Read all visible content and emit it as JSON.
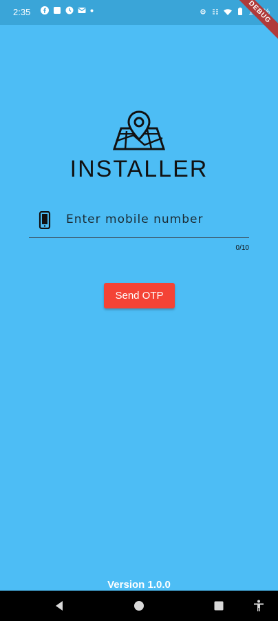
{
  "status_bar": {
    "time": "2:35",
    "left_icons": [
      "facebook-icon",
      "square-notification-icon",
      "clock-icon",
      "gmail-icon",
      "dot-icon"
    ],
    "right_icons": [
      "vibrate-icon",
      "data-icon",
      "wifi-icon",
      "battery-icon"
    ],
    "battery": "100%"
  },
  "debug_banner": "DEBUG",
  "app": {
    "title": "INSTALLER",
    "logo_icon": "map-location-icon"
  },
  "mobile_field": {
    "placeholder": "Enter mobile number",
    "value": "",
    "counter": "0/10",
    "icon": "smartphone-icon"
  },
  "send_otp_label": "Send OTP",
  "version_label": "Version 1.0.0",
  "colors": {
    "background": "#4DBDF5",
    "status_bar": "#3AA5D8",
    "button": "#F44336",
    "nav_bar": "#000000"
  },
  "nav_bar": {
    "buttons": [
      "back-icon",
      "home-icon",
      "recents-icon",
      "accessibility-icon"
    ]
  }
}
